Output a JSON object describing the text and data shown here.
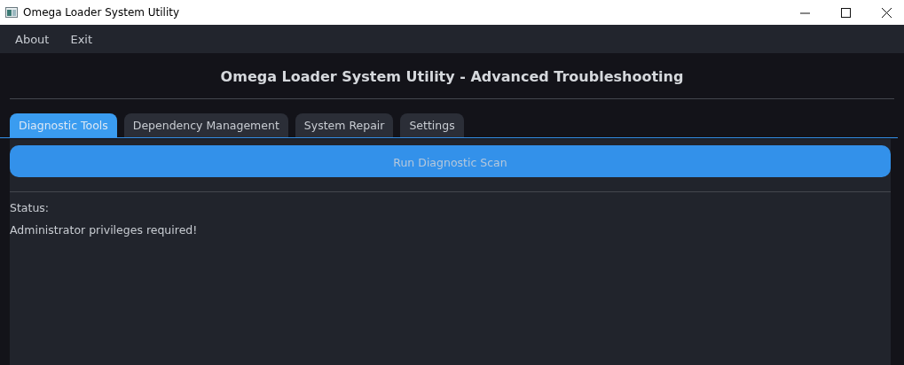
{
  "window": {
    "title": "Omega Loader System Utility"
  },
  "menu": [
    "About",
    "Exit"
  ],
  "heading": "Omega Loader System Utility - Advanced Troubleshooting",
  "tabs": [
    {
      "label": "Diagnostic Tools",
      "selected": true
    },
    {
      "label": "Dependency Management",
      "selected": false
    },
    {
      "label": "System Repair",
      "selected": false
    },
    {
      "label": "Settings",
      "selected": false
    }
  ],
  "scan_button": "Run Diagnostic Scan",
  "status_label": "Status:",
  "status_message": "Administrator privileges required!"
}
